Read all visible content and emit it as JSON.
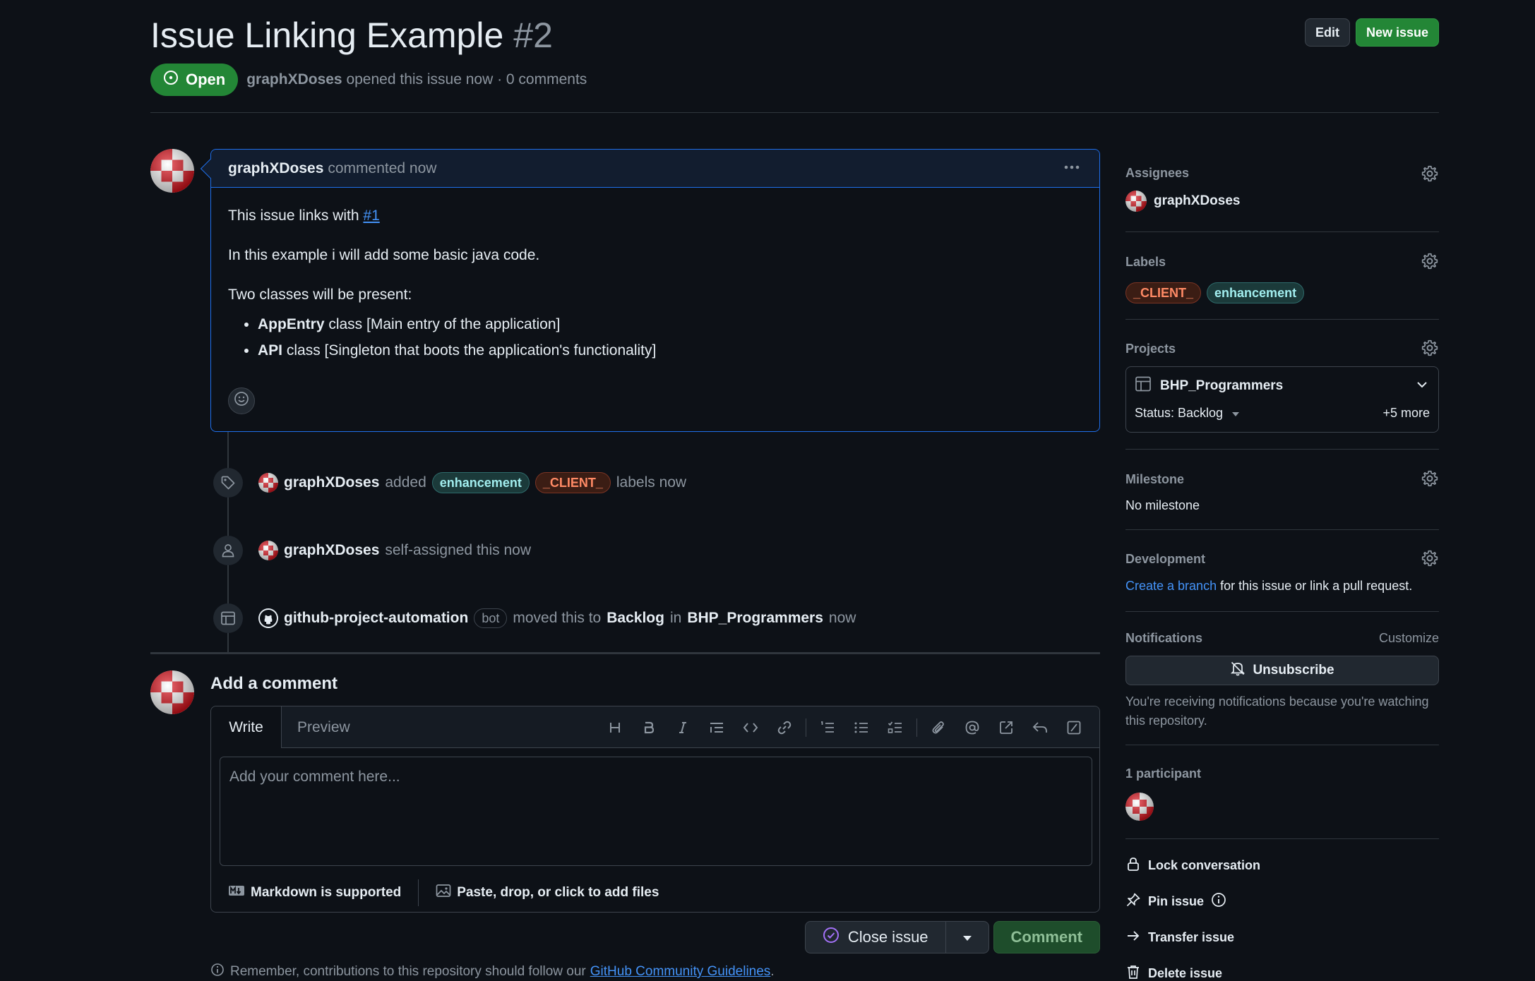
{
  "issue": {
    "title": "Issue Linking Example",
    "number": "#2",
    "state": "Open",
    "author": "graphXDoses",
    "opened_meta": "opened this issue now · 0 comments"
  },
  "header_buttons": {
    "edit": "Edit",
    "new_issue": "New issue"
  },
  "comment": {
    "author": "graphXDoses",
    "meta": "commented now",
    "line1_prefix": "This issue links with",
    "line1_link": "#1",
    "line2": "In this example i will add some basic java code.",
    "line3": "Two classes will be present:",
    "bullets": [
      {
        "bold": "AppEntry",
        "rest": " class [Main entry of the application]"
      },
      {
        "bold": "API",
        "rest": " class [Singleton that boots the application's functionality]"
      }
    ]
  },
  "timeline": {
    "labels_event": {
      "actor": "graphXDoses",
      "verb": "added",
      "label1": "enhancement",
      "label2": "_CLIENT_",
      "suffix": "labels now"
    },
    "assign_event": {
      "actor": "graphXDoses",
      "text": "self-assigned this now"
    },
    "project_event": {
      "actor": "github-project-automation",
      "badge": "bot",
      "text1": "moved this to",
      "status": "Backlog",
      "text2": "in",
      "project": "BHP_Programmers",
      "text3": "now"
    }
  },
  "add_comment": {
    "title": "Add a comment",
    "tab_write": "Write",
    "tab_preview": "Preview",
    "placeholder": "Add your comment here...",
    "markdown_note": "Markdown is supported",
    "files_note": "Paste, drop, or click to add files",
    "close_issue": "Close issue",
    "comment_button": "Comment",
    "remember_prefix": "Remember, contributions to this repository should follow our",
    "remember_link": "GitHub Community Guidelines",
    "remember_suffix": "."
  },
  "sidebar": {
    "assignees_title": "Assignees",
    "assignee": "graphXDoses",
    "labels_title": "Labels",
    "labels": [
      "_CLIENT_",
      "enhancement"
    ],
    "projects_title": "Projects",
    "project_name": "BHP_Programmers",
    "project_status": "Status: Backlog",
    "project_more": "+5 more",
    "milestone_title": "Milestone",
    "milestone_value": "No milestone",
    "development_title": "Development",
    "dev_link": "Create a branch",
    "dev_text": "for this issue or link a pull request.",
    "notifications_title": "Notifications",
    "customize": "Customize",
    "unsubscribe": "Unsubscribe",
    "notif_note": "You're receiving notifications because you're watching this repository.",
    "participants": "1 participant",
    "lock": "Lock conversation",
    "pin": "Pin issue",
    "transfer": "Transfer issue",
    "delete": "Delete issue"
  },
  "colors": {
    "open_green": "#238636",
    "link_blue": "#4493f8",
    "bg": "#0d1117",
    "comment_border": "#1f6feb"
  }
}
